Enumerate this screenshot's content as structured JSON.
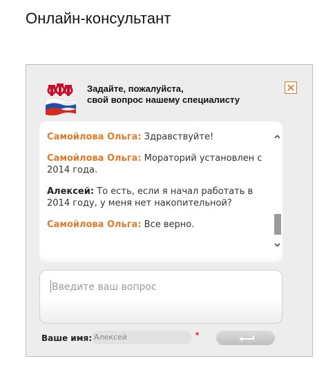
{
  "page": {
    "title": "Онлайн-консультант"
  },
  "widget": {
    "header": {
      "line1": "Задайте, пожалуйста,",
      "line2": "свой вопрос нашему специалисту"
    },
    "messages": [
      {
        "author": "Самойлова Ольга:",
        "role": "operator",
        "text": " Здравствуйте!"
      },
      {
        "author": "Самойлова Ольга:",
        "role": "operator",
        "text": " Мораторий установлен с 2014 года."
      },
      {
        "author": "Алексей:",
        "role": "user",
        "text": " То есть, если я начал работать в 2014 году, у меня нет накопительной?"
      },
      {
        "author": "Самойлова Ольга:",
        "role": "operator",
        "text": " Все верно."
      }
    ],
    "input": {
      "placeholder": "Введите ваш вопрос"
    },
    "name": {
      "label": "Ваше имя:",
      "value": "Алексей",
      "required_mark": "*"
    },
    "colors": {
      "operator": "#e07b2a",
      "close": "#e07b2a",
      "required": "#e31e24"
    },
    "icons": {
      "logo": "pfr-logo",
      "close": "close-icon",
      "send": "enter-arrow-icon"
    }
  }
}
